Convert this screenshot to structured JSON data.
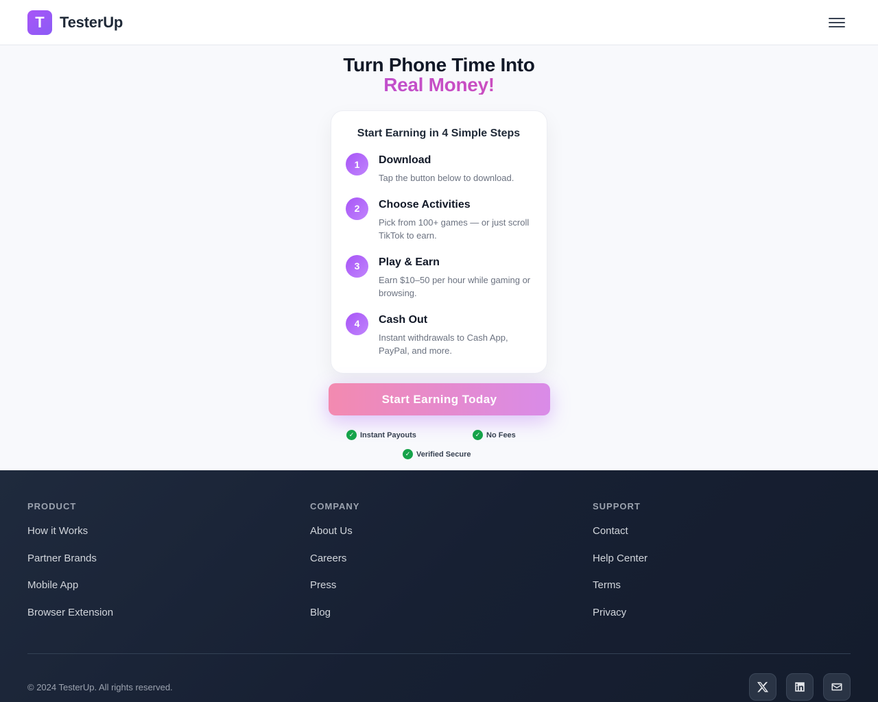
{
  "header": {
    "logo_letter": "T",
    "brand": "TesterUp"
  },
  "hero": {
    "title_line1": "Turn Phone Time Into",
    "title_line2": "Real Money!"
  },
  "steps": {
    "title": "Start Earning in 4 Simple Steps",
    "items": [
      {
        "num": "1",
        "title": "Download",
        "desc": "Tap the button below to download."
      },
      {
        "num": "2",
        "title": "Choose Activities",
        "desc": "Pick from 100+ games — or just scroll TikTok to earn."
      },
      {
        "num": "3",
        "title": "Play & Earn",
        "desc": "Earn $10–50 per hour while gaming or browsing."
      },
      {
        "num": "4",
        "title": "Cash Out",
        "desc": "Instant withdrawals to Cash App, PayPal, and more."
      }
    ]
  },
  "cta": {
    "label": "Start Earning Today"
  },
  "badges": [
    "Instant Payouts",
    "No Fees",
    "Verified Secure"
  ],
  "footer": {
    "columns": [
      {
        "heading": "PRODUCT",
        "links": [
          "How it Works",
          "Partner Brands",
          "Mobile App",
          "Browser Extension"
        ]
      },
      {
        "heading": "COMPANY",
        "links": [
          "About Us",
          "Careers",
          "Press",
          "Blog"
        ]
      },
      {
        "heading": "SUPPORT",
        "links": [
          "Contact",
          "Help Center",
          "Terms",
          "Privacy"
        ]
      }
    ],
    "copyright": "© 2024 TesterUp. All rights reserved.",
    "socials": [
      "x-icon",
      "linkedin-icon",
      "mail-icon"
    ]
  },
  "colors": {
    "brand": "#8b5cf6",
    "accent_gradient_start": "#9f55f2",
    "accent_gradient_end": "#ec4899",
    "success": "#16a34a",
    "footer_bg": "#172033"
  }
}
